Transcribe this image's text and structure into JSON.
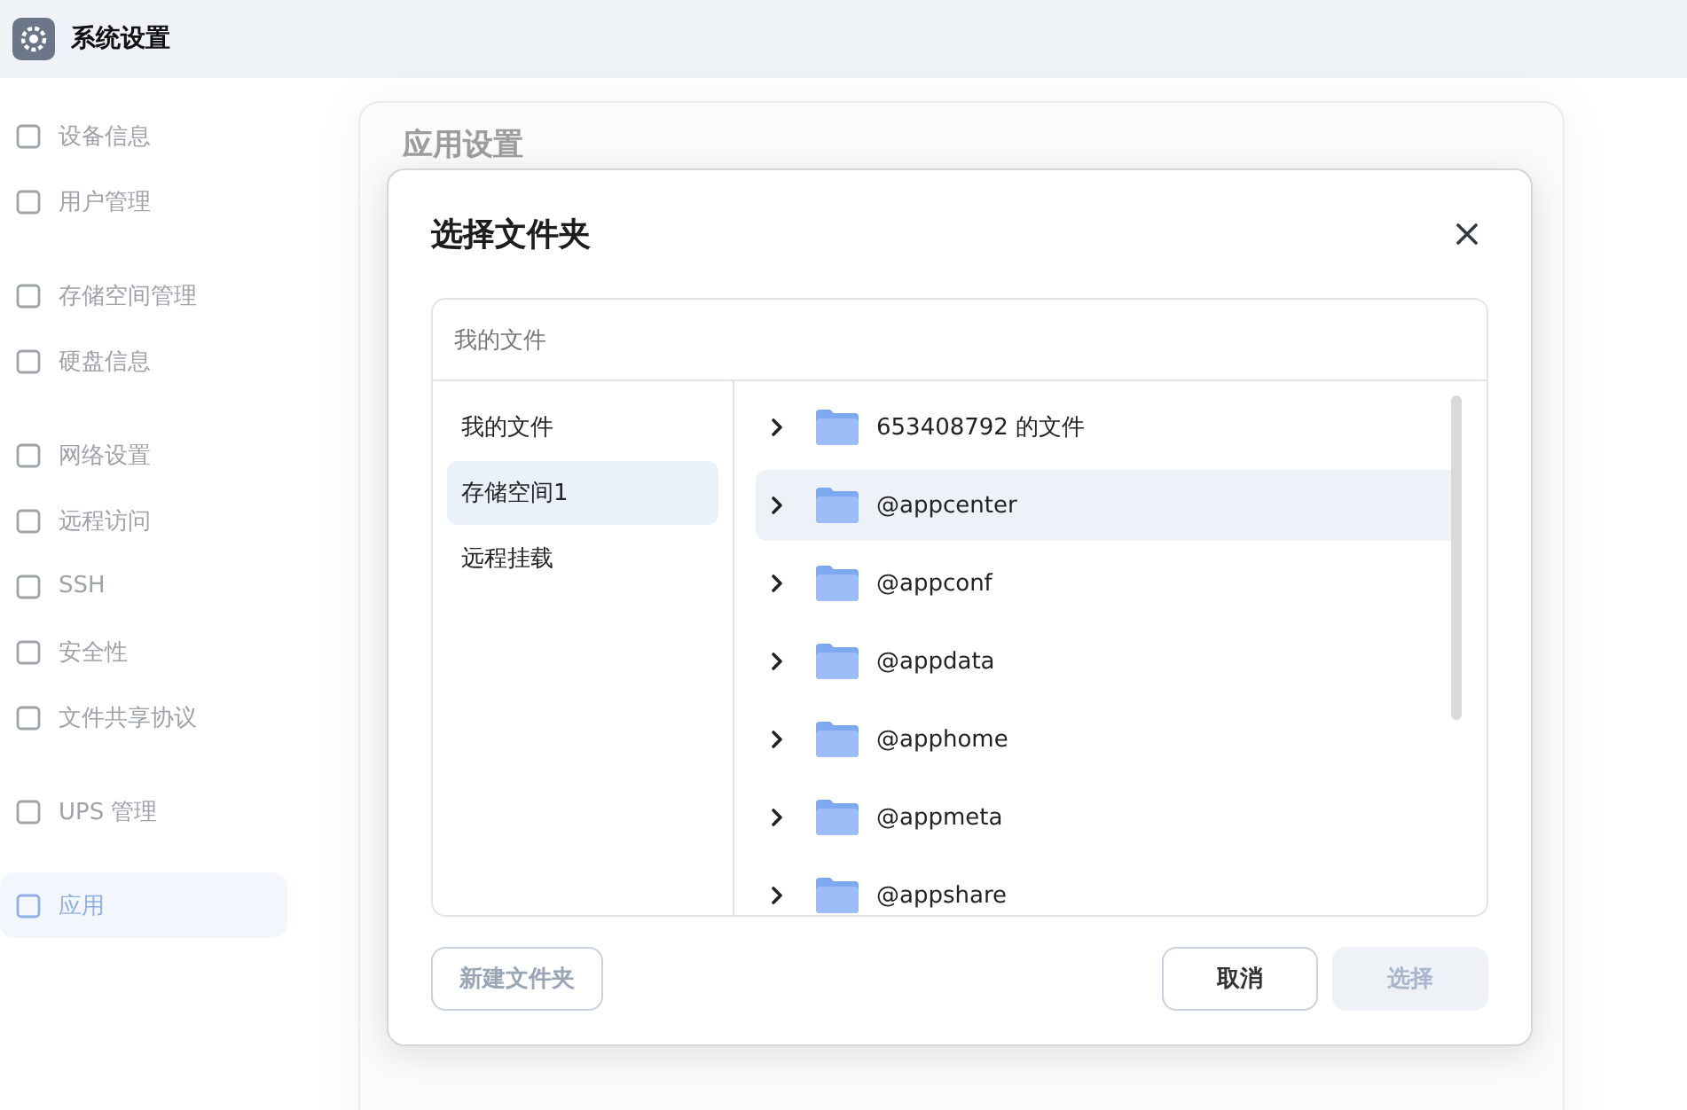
{
  "app": {
    "title": "系统设置"
  },
  "sidebar": {
    "groups": [
      {
        "items": [
          {
            "label": "设备信息",
            "selected": false
          },
          {
            "label": "用户管理",
            "selected": false
          }
        ]
      },
      {
        "items": [
          {
            "label": "存储空间管理",
            "selected": false
          },
          {
            "label": "硬盘信息",
            "selected": false
          }
        ]
      },
      {
        "items": [
          {
            "label": "网络设置",
            "selected": false
          },
          {
            "label": "远程访问",
            "selected": false
          },
          {
            "label": "SSH",
            "selected": false
          },
          {
            "label": "安全性",
            "selected": false
          },
          {
            "label": "文件共享协议",
            "selected": false
          }
        ]
      },
      {
        "items": [
          {
            "label": "UPS 管理",
            "selected": false
          }
        ]
      },
      {
        "items": [
          {
            "label": "应用",
            "selected": true
          }
        ]
      }
    ]
  },
  "back_dialog": {
    "title": "应用设置"
  },
  "dialog": {
    "title": "选择文件夹",
    "path": "我的文件",
    "locations": [
      {
        "label": "我的文件",
        "selected": false
      },
      {
        "label": "存储空间1",
        "selected": true
      },
      {
        "label": "远程挂载",
        "selected": false
      }
    ],
    "folders": [
      {
        "name": "653408792 的文件",
        "expanded": false,
        "selected": false
      },
      {
        "name": "@appcenter",
        "expanded": false,
        "selected": true
      },
      {
        "name": "@appconf",
        "expanded": false,
        "selected": false
      },
      {
        "name": "@appdata",
        "expanded": false,
        "selected": false
      },
      {
        "name": "@apphome",
        "expanded": false,
        "selected": false
      },
      {
        "name": "@appmeta",
        "expanded": false,
        "selected": false
      },
      {
        "name": "@appshare",
        "expanded": false,
        "selected": false
      }
    ],
    "new_folder": {
      "label": "新建文件夹",
      "disabled": true
    },
    "cancel": {
      "label": "取消",
      "disabled": false
    },
    "confirm": {
      "label": "选择",
      "disabled": true
    }
  }
}
